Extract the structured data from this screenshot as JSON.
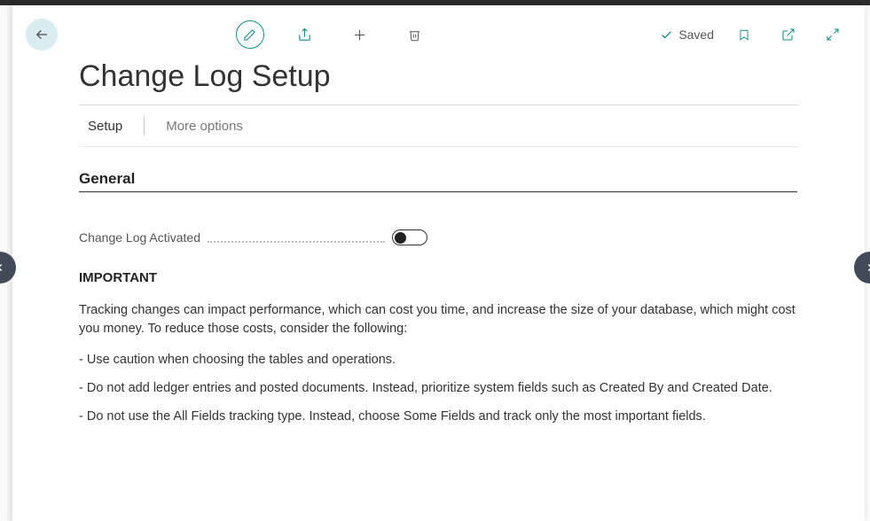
{
  "toolbar": {
    "saved_label": "Saved"
  },
  "page": {
    "title": "Change Log Setup"
  },
  "tabs": {
    "setup": "Setup",
    "more_options": "More options"
  },
  "section": {
    "general": "General"
  },
  "fields": {
    "change_log_activated_label": "Change Log Activated",
    "change_log_activated_value": false
  },
  "important": {
    "heading": "IMPORTANT",
    "intro": "Tracking changes can impact performance, which can cost you time, and increase the size of your database, which might cost you money. To reduce those costs, consider the following:",
    "bullets": [
      "- Use caution when choosing the tables and operations.",
      "- Do not add ledger entries and posted documents. Instead, prioritize system fields such as Created By and Created Date.",
      "- Do not use the All Fields tracking type. Instead, choose Some Fields and track only the most important fields."
    ]
  }
}
